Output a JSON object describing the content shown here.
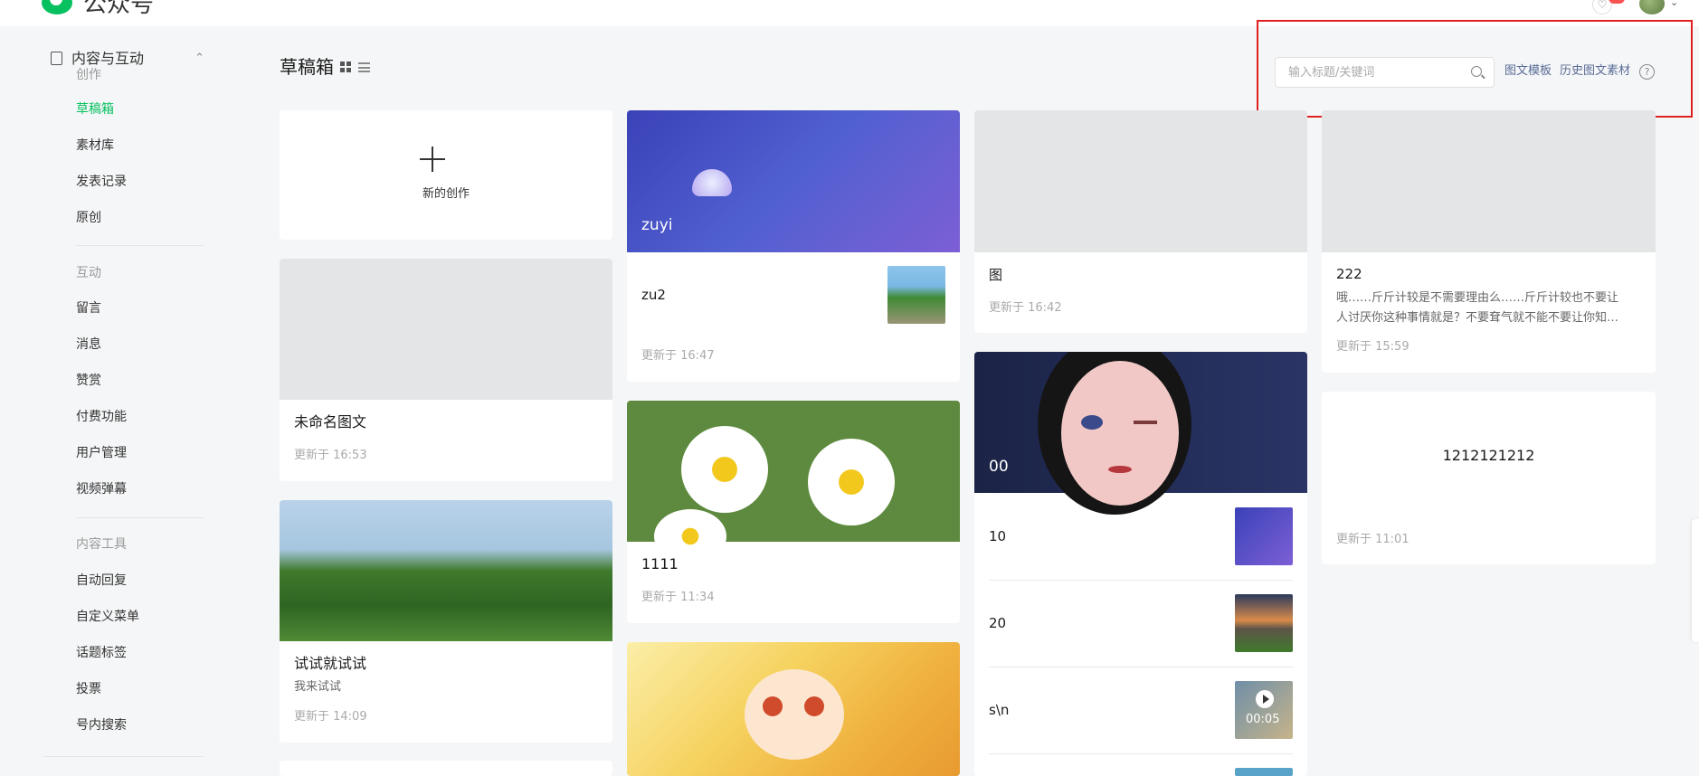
{
  "header": {
    "app_name": "公众号",
    "brand_color": "#07c160"
  },
  "sidebar": {
    "group_label": "内容与互动",
    "items": [
      {
        "label": "创作",
        "type": "section"
      },
      {
        "label": "草稿箱",
        "type": "item",
        "active": true
      },
      {
        "label": "素材库",
        "type": "item"
      },
      {
        "label": "发表记录",
        "type": "item"
      },
      {
        "label": "原创",
        "type": "item"
      },
      {
        "label": "互动",
        "type": "section"
      },
      {
        "label": "留言",
        "type": "item"
      },
      {
        "label": "消息",
        "type": "item"
      },
      {
        "label": "赞赏",
        "type": "item"
      },
      {
        "label": "付费功能",
        "type": "item"
      },
      {
        "label": "用户管理",
        "type": "item"
      },
      {
        "label": "视频弹幕",
        "type": "item"
      },
      {
        "label": "内容工具",
        "type": "section"
      },
      {
        "label": "自动回复",
        "type": "item"
      },
      {
        "label": "自定义菜单",
        "type": "item"
      },
      {
        "label": "话题标签",
        "type": "item"
      },
      {
        "label": "投票",
        "type": "item"
      },
      {
        "label": "号内搜索",
        "type": "item"
      }
    ]
  },
  "page": {
    "title": "草稿箱",
    "search_placeholder": "输入标题/关键词",
    "link_template": "图文模板",
    "link_history": "历史图文素材",
    "help_glyph": "?"
  },
  "cards": {
    "new_card_label": "新的创作",
    "c_untitled": {
      "title": "未命名图文",
      "time": "更新于 16:53"
    },
    "c_test": {
      "title": "试试就试试",
      "sub": "我来试试",
      "time": "更新于 14:09"
    },
    "c_zuyi": {
      "cover_title": "zuyi",
      "item_title": "zu2",
      "time": "更新于 16:47"
    },
    "c_1111": {
      "title": "1111",
      "time": "更新于 11:34"
    },
    "c_tu": {
      "title": "图",
      "time": "更新于 16:42"
    },
    "c_00": {
      "cover_title": "00",
      "rows": [
        "10",
        "20",
        "s\\n"
      ],
      "video_duration": "00:05"
    },
    "c_222": {
      "title": "222",
      "sub_line1": "哦……斤斤计较是不需要理由么……斤斤计较也不要让",
      "sub_line2": "人讨厌你这种事情就是？不要耷气就不能不要让你知…",
      "time": "更新于 15:59"
    },
    "c_1212": {
      "title": "1212121212",
      "time": "更新于 11:01"
    }
  }
}
